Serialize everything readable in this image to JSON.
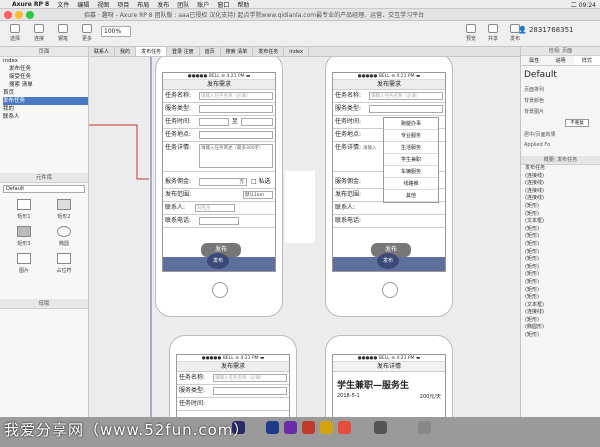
{
  "menubar": {
    "app": "Axure RP 8",
    "items": [
      "文件",
      "编辑",
      "视图",
      "项目",
      "布局",
      "发布",
      "团队",
      "账户",
      "窗口",
      "帮助"
    ],
    "clock": "二 09:24"
  },
  "titlebar": {
    "text": "招募 · 趣呀 - Axure RP 8 团队版 : aaa已授权 汉化支持) 起点学院www.qidianla.com最专业的产品经理、运营、交互学习平台"
  },
  "toolbar": {
    "tools": [
      "选择",
      "连接",
      "钢笔",
      "更多"
    ],
    "zoom": "100%",
    "right_tools": [
      "预览",
      "共享",
      "发布"
    ],
    "user_id": "2831768351"
  },
  "left_panel": {
    "pages_title": "页面",
    "pages": [
      "index",
      "发布任务",
      "接受任务",
      "搜索 清单",
      "首页",
      "发布任务",
      "我的",
      "联系人"
    ],
    "selected_page_index": 5,
    "library_title": "元件库",
    "library_select": "Default",
    "widgets": [
      "矩形1",
      "矩形2",
      "矩形3",
      "椭圆",
      "图片",
      "占位符"
    ],
    "masters_title": "母版"
  },
  "canvas_tabs": [
    "联系人",
    "我的",
    "发布任务",
    "登录 注册",
    "首页",
    "搜索 清单",
    "发布任务",
    "index"
  ],
  "active_tab_index": 2,
  "phone_a": {
    "status": "●●●●● BELL ⊜    4:21 PM    ▬",
    "nav_title": "发布需求",
    "fields": [
      {
        "label": "任务名称:",
        "placeholder": "请输入任务名称（必填）"
      },
      {
        "label": "服务类型:",
        "placeholder": ""
      },
      {
        "label": "任务时间:",
        "placeholder": "",
        "to": "至"
      },
      {
        "label": "任务地点:",
        "placeholder": ""
      },
      {
        "label": "任务详情:",
        "placeholder": "请输入任务简述（最多300字）"
      }
    ],
    "extra_rows": [
      {
        "label": "报务佣金:",
        "value": "元",
        "check": "私选"
      },
      {
        "label": "发布范围:",
        "value": "默认1km"
      },
      {
        "label": "联系人:",
        "value": "刘先生"
      },
      {
        "label": "联系电话:",
        "value": ""
      }
    ],
    "submit": "发布",
    "tab_publish": "发布"
  },
  "phone_b": {
    "status": "●●●●● BELL ⊜    4:21 PM    ▬",
    "nav_title": "发布需求",
    "fields": [
      "任务名称:",
      "服务类型:",
      "任务时间:",
      "任务地点:",
      "任务详情:"
    ],
    "name_placeholder": "请输入任务名称（必填）",
    "detail_placeholder": "请输入",
    "extra_rows": [
      "服务佣金:",
      "发布范围:",
      "联系人:",
      "联系电话:"
    ],
    "dropdown": [
      "跑腿办事",
      "专业服务",
      "生活服务",
      "学生兼职",
      "车辆服务",
      "线路推",
      "其他"
    ],
    "submit": "发布",
    "tab_publish": "发布"
  },
  "phone_c": {
    "status": "●●●●● BELL ⊜    4:21 PM    ▬",
    "nav_title": "发布需求",
    "fields": [
      "任务名称:",
      "服务类型:",
      "任务时间:"
    ],
    "name_placeholder": "请输入任务名称（必填）"
  },
  "phone_d": {
    "status": "●●●●● BELL ⊜    4:21 PM    ▬",
    "nav_title": "发布详情",
    "headline": "学生兼职—服务生",
    "date": "2018-5-1",
    "price": "200元/天"
  },
  "right_panel": {
    "title": "检视: 页面",
    "tabs": [
      "属性",
      "说明",
      "样式"
    ],
    "style_name": "Default",
    "rows": [
      "页面排列",
      "背景颜色",
      "背景图片",
      "不重复",
      "居中/页面效果",
      "Applied Fo"
    ],
    "outline_title": "概要: 发布任务",
    "outline_items": [
      "发布任务",
      "(连接线)",
      "(连接线)",
      "(连接线)",
      "(连接线)",
      "(矩形)",
      "(矩形)",
      "(文本框)",
      "(矩形)",
      "(矩形)",
      "(矩形)",
      "(矩形)",
      "(矩形)",
      "(矩形)",
      "(矩形)",
      "(矩形)",
      "(矩形)",
      "(矩形)",
      "(文本框)",
      "(连接线)",
      "(矩形)",
      "(椭圆形)",
      "(矩形)"
    ]
  },
  "watermark": "我爱分享网（www.52fun.com）",
  "colors": {
    "tabbar": "#5f6f9c",
    "selection": "#4a78c2",
    "connector": "#c0392b"
  }
}
